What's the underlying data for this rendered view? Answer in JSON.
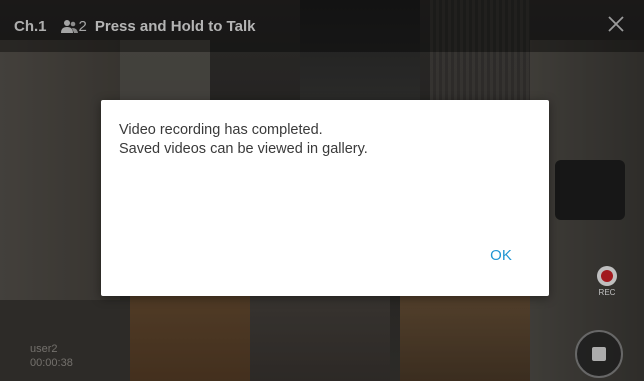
{
  "topbar": {
    "channel": "Ch.1",
    "participant_count": "2",
    "push_to_talk": "Press and Hold to Talk",
    "icons": {
      "participants": "people-icon",
      "close": "close-icon"
    }
  },
  "overlay_info": {
    "username": "user2",
    "elapsed": "00:00:38"
  },
  "controls": {
    "rec_label": "REC",
    "rec_icon": "record-dot-icon",
    "stop_icon": "stop-square-icon"
  },
  "dialog": {
    "line1": "Video recording has completed.",
    "line2": "Saved videos can be viewed in gallery.",
    "ok_label": "OK"
  },
  "colors": {
    "accent": "#2196d3",
    "record_red": "#d8232a",
    "dialog_bg": "#ffffff"
  }
}
